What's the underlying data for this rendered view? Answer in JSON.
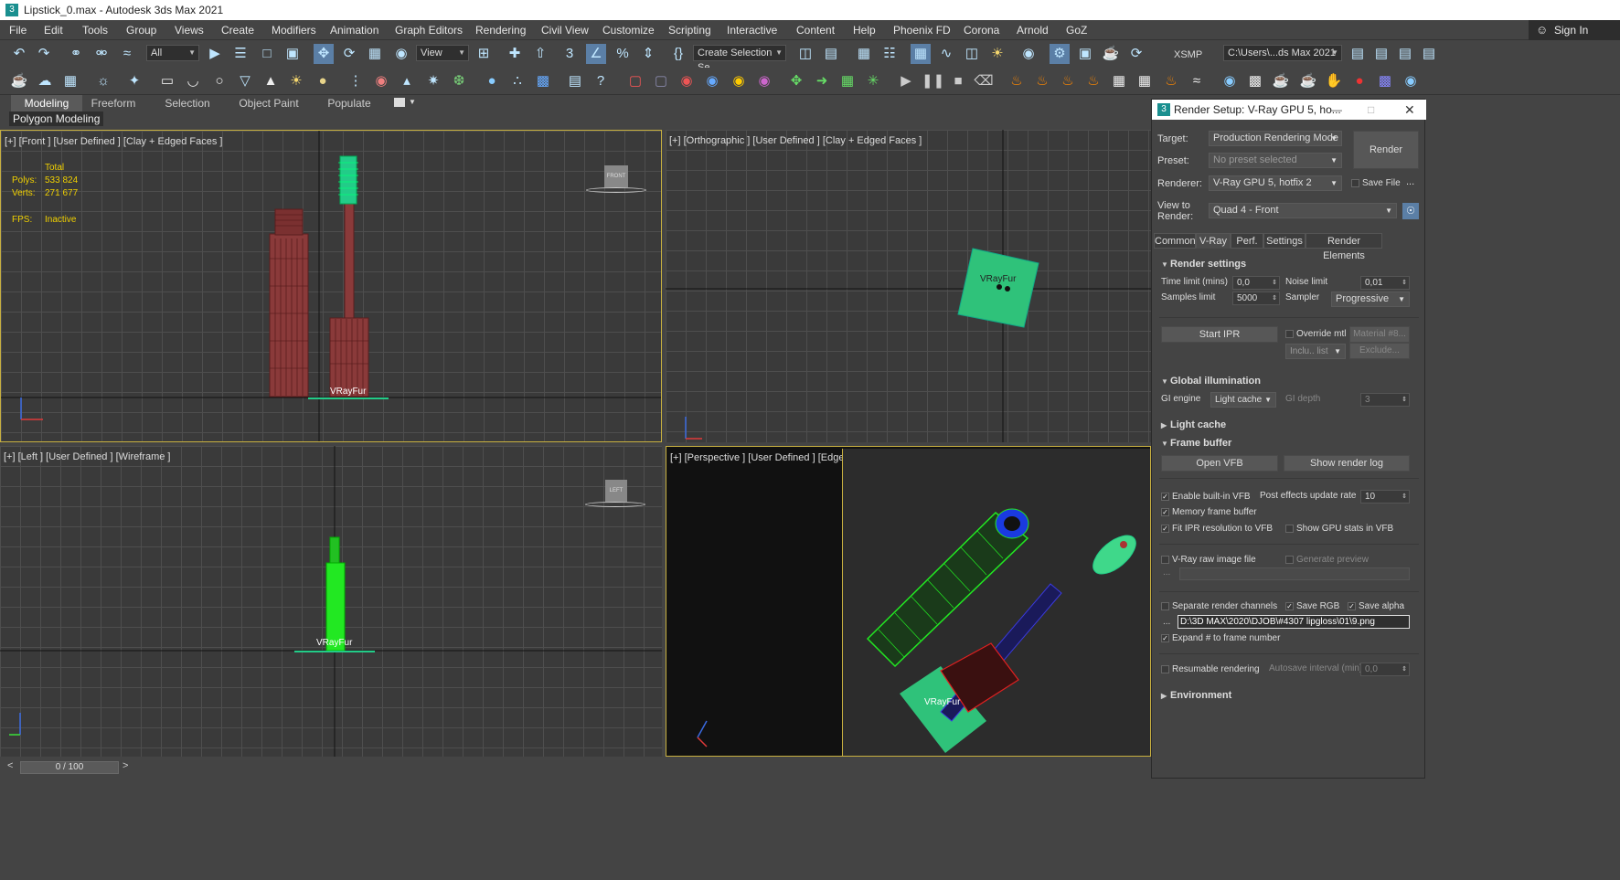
{
  "window": {
    "title": "Lipstick_0.max - Autodesk 3ds Max 2021"
  },
  "menu": [
    "File",
    "Edit",
    "Tools",
    "Group",
    "Views",
    "Create",
    "Modifiers",
    "Animation",
    "Graph Editors",
    "Rendering",
    "Civil View",
    "Customize",
    "Scripting",
    "Interactive",
    "Content",
    "Help",
    "Phoenix FD",
    "Corona",
    "Arnold",
    "GoZ"
  ],
  "account": {
    "sign_in": "Sign In"
  },
  "toolbar": {
    "filter": "All",
    "ref_coord": "View",
    "selection_set": "Create Selection Se",
    "workspace": "XSMP",
    "project_path": "C:\\Users\\...ds Max 2021"
  },
  "ribbon": {
    "tabs": [
      "Modeling",
      "Freeform",
      "Selection",
      "Object Paint",
      "Populate"
    ],
    "active": "Modeling",
    "sub": "Polygon Modeling"
  },
  "viewports": {
    "front": {
      "label": "[+] [Front ] [User Defined ] [Clay + Edged Faces ]",
      "stats": {
        "total_label": "Total",
        "polys_label": "Polys:",
        "polys": "533 824",
        "verts_label": "Verts:",
        "verts": "271 677",
        "fps_label": "FPS:",
        "fps": "Inactive"
      },
      "object_label": "VRayFur",
      "viewcube": "FRONT"
    },
    "ortho": {
      "label": "[+] [Orthographic ] [User Defined ] [Clay + Edged Faces ]",
      "object_label": "VRayFur"
    },
    "left": {
      "label": "[+] [Left ] [User Defined ] [Wireframe ]",
      "object_label": "VRayFur",
      "viewcube": "LEFT"
    },
    "perspective": {
      "label": "[+] [Perspective ] [User Defined ] [Edged Faces ]",
      "object_label": "VRayFur"
    }
  },
  "timeline": {
    "frame": "0 / 100"
  },
  "render_setup": {
    "title": "Render Setup: V-Ray GPU 5, ho...",
    "target_label": "Target:",
    "target": "Production Rendering Mode",
    "preset_label": "Preset:",
    "preset": "No preset selected",
    "renderer_label": "Renderer:",
    "renderer": "V-Ray GPU 5, hotfix 2",
    "save_file": "Save File",
    "view_label_1": "View to",
    "view_label_2": "Render:",
    "view": "Quad 4 - Front",
    "render_button": "Render",
    "tabs": [
      "Common",
      "V-Ray",
      "Perf.",
      "Settings",
      "Render Elements"
    ],
    "active_tab": "V-Ray",
    "render_settings": {
      "heading": "Render settings",
      "time_limit_label": "Time limit (mins)",
      "time_limit": "0,0",
      "noise_limit_label": "Noise limit",
      "noise_limit": "0,01",
      "samples_limit_label": "Samples limit",
      "samples_limit": "5000",
      "sampler_label": "Sampler",
      "sampler": "Progressive",
      "start_ipr": "Start IPR",
      "override_mtl": "Override mtl",
      "material": "Material #8...",
      "include_list": "Inclu.. list",
      "exclude": "Exclude..."
    },
    "gi": {
      "heading": "Global illumination",
      "engine_label": "GI engine",
      "engine": "Light cache",
      "depth_label": "GI depth",
      "depth": "3"
    },
    "light_cache": {
      "heading": "Light cache"
    },
    "frame_buffer": {
      "heading": "Frame buffer",
      "open_vfb": "Open VFB",
      "show_log": "Show render log",
      "enable_vfb": "Enable built-in VFB",
      "post_effects_label": "Post effects update rate",
      "post_effects": "10",
      "memory_fb": "Memory frame buffer",
      "fit_ipr": "Fit IPR resolution to VFB",
      "gpu_stats": "Show GPU stats in VFB",
      "raw_file": "V-Ray raw image file",
      "generate_preview": "Generate preview",
      "dots": "...",
      "separate_channels": "Separate render channels",
      "save_rgb": "Save RGB",
      "save_alpha": "Save alpha",
      "path": "D:\\3D MAX\\2020\\DJOB\\#4307 lipgloss\\01\\9.png",
      "expand_frame": "Expand # to frame number",
      "resumable": "Resumable rendering",
      "autosave_label": "Autosave interval (min)",
      "autosave": "0,0"
    },
    "environment": {
      "heading": "Environment"
    }
  },
  "colors": {
    "viewport_bg": "#3a3a3a",
    "accent": "#f0d000",
    "active_border": "#c8b040",
    "wire_green": "#00ff00"
  }
}
